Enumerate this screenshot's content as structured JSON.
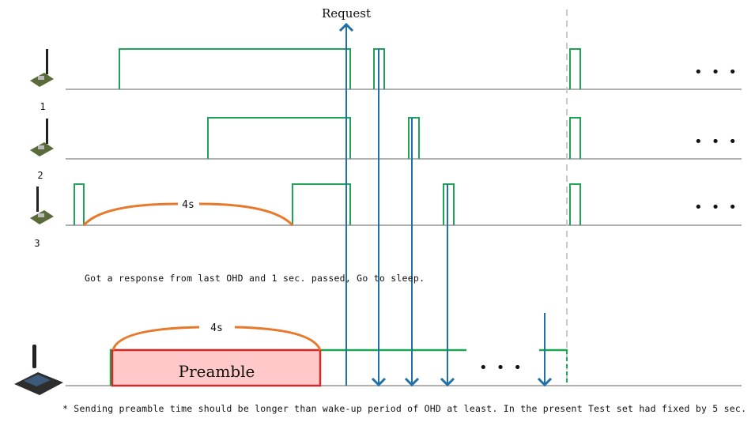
{
  "request_label": "Request",
  "nodes": [
    {
      "label": "1"
    },
    {
      "label": "2"
    },
    {
      "label": "3"
    }
  ],
  "duration_label_top": "4s",
  "duration_label_bottom": "4s",
  "preamble_label": "Preamble",
  "sleep_note": "Got a response from last OHD and 1 sec. passed, Go to sleep.",
  "footnote": "* Sending preamble time should be longer than wake-up period of OHD at least. In the present Test set had fixed by 5 sec.",
  "ellipsis": "• • •",
  "colors": {
    "signal": "#1fa356",
    "arrow": "#1f6fa8",
    "arc": "#e8782a",
    "preamble_fill": "#ffc9c9",
    "preamble_border": "#d12a2a",
    "baseline": "#b0b0b0"
  }
}
